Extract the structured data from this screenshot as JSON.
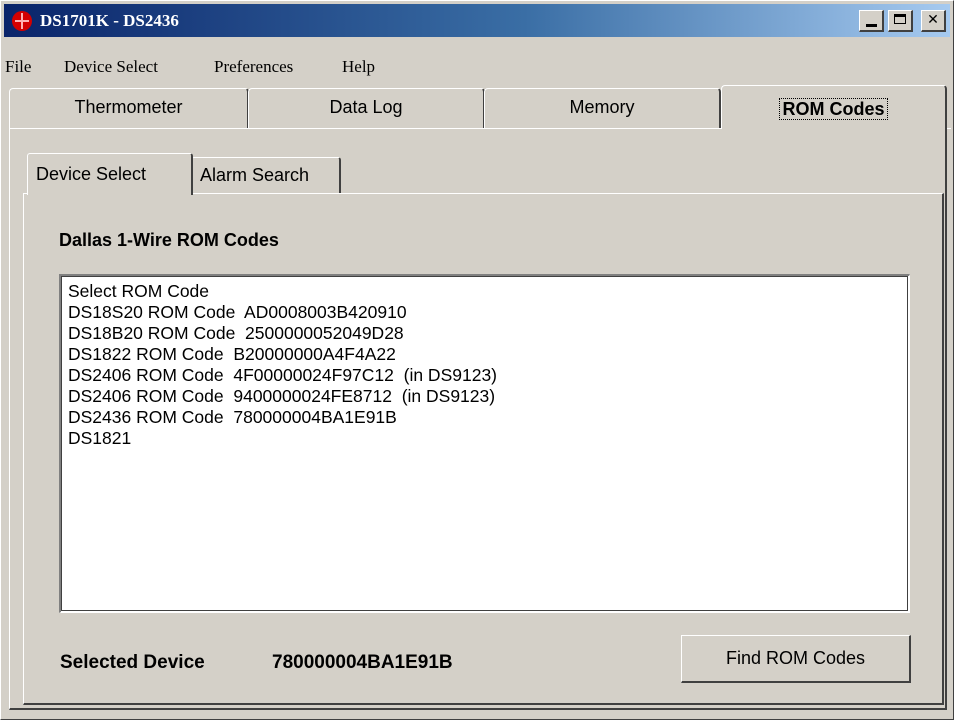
{
  "window": {
    "title": "DS1701K - DS2436",
    "close_glyph": "✕"
  },
  "menu": [
    "File",
    "Device Select",
    "Preferences",
    "Help"
  ],
  "tabs": [
    "Thermometer",
    "Data Log",
    "Memory",
    "ROM Codes"
  ],
  "active_tab": "ROM Codes",
  "subtabs": [
    "Device Select",
    "Alarm Search"
  ],
  "active_subtab": "Device Select",
  "rom_codes": {
    "heading": "Dallas 1-Wire ROM Codes",
    "items": [
      "Select ROM Code",
      "DS18S20 ROM Code  AD0008003B420910",
      "DS18B20 ROM Code  2500000052049D28",
      "DS1822 ROM Code  B20000000A4F4A22",
      "DS2406 ROM Code  4F00000024F97C12  (in DS9123)",
      "DS2406 ROM Code  9400000024FE8712  (in DS9123)",
      "DS2436 ROM Code  780000004BA1E91B",
      "DS1821"
    ]
  },
  "selected_device": {
    "label": "Selected Device",
    "value": "780000004BA1E91B"
  },
  "find_button": "Find ROM Codes",
  "colors": {
    "title_gradient_start": "#0a246a",
    "title_gradient_end": "#a6caf0",
    "face": "#d4d0c8"
  }
}
